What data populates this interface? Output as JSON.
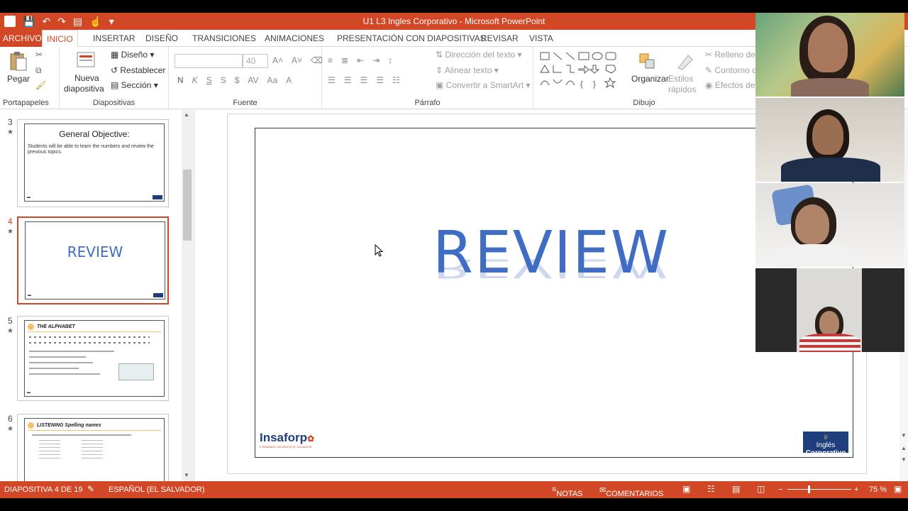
{
  "window": {
    "title": "U1 L3 Ingles Corporativo -  Microsoft PowerPoint",
    "app_letter": "P"
  },
  "tabs": [
    {
      "label": "ARCHIVO"
    },
    {
      "label": "INICIO"
    },
    {
      "label": "INSERTAR"
    },
    {
      "label": "DISEÑO"
    },
    {
      "label": "TRANSICIONES"
    },
    {
      "label": "ANIMACIONES"
    },
    {
      "label": "PRESENTACIÓN CON DIAPOSITIVAS"
    },
    {
      "label": "REVISAR"
    },
    {
      "label": "VISTA"
    }
  ],
  "ribbon": {
    "portapapeles": {
      "label": "Portapapeles",
      "pegar": "Pegar"
    },
    "diapositivas": {
      "label": "Diapositivas",
      "nueva_line1": "Nueva",
      "nueva_line2": "diapositiva",
      "diseno": "Diseño",
      "restablecer": "Restablecer",
      "seccion": "Sección"
    },
    "fuente": {
      "label": "Fuente",
      "size": "40",
      "bold": "N",
      "italic": "K",
      "underline": "S",
      "shadow": "S",
      "spacing": "AV",
      "case": "Aa",
      "color": "A"
    },
    "parrafo": {
      "label": "Párrafo",
      "direccion": "Dirección del texto",
      "alinear": "Alinear texto",
      "convertir": "Convertir a SmartArt"
    },
    "dibujo": {
      "label": "Dibujo",
      "organizar": "Organizar",
      "estilos_line1": "Estilos",
      "estilos_line2": "rápidos",
      "relleno": "Relleno de",
      "contorno": "Contorno d",
      "efectos": "Efectos de"
    }
  },
  "thumbnails": [
    {
      "number": "3",
      "title": "General Objective:",
      "body": "Students will be able to learn the numbers and review the previous topics."
    },
    {
      "number": "4",
      "title": "REVIEW"
    },
    {
      "number": "5",
      "title": "THE ALPHABET"
    },
    {
      "number": "6",
      "title": "LISTENING  Spelling names"
    }
  ],
  "slide": {
    "title": "REVIEW",
    "logo": "Insaforp",
    "logo_tagline": "FORMANDO UN MEJOR EL SALVADOR",
    "brand_line1": "Inglés",
    "brand_line2": "Corporativo"
  },
  "status": {
    "slide_info": "DIAPOSITIVA 4 DE 19",
    "language": "ESPAÑOL (EL SALVADOR)",
    "notes": "NOTAS",
    "comments": "COMENTARIOS",
    "zoom": "75 %"
  },
  "colors": {
    "accent": "#D24726",
    "slide_title": "#3F6DC3",
    "brand": "#1F3E7C"
  }
}
